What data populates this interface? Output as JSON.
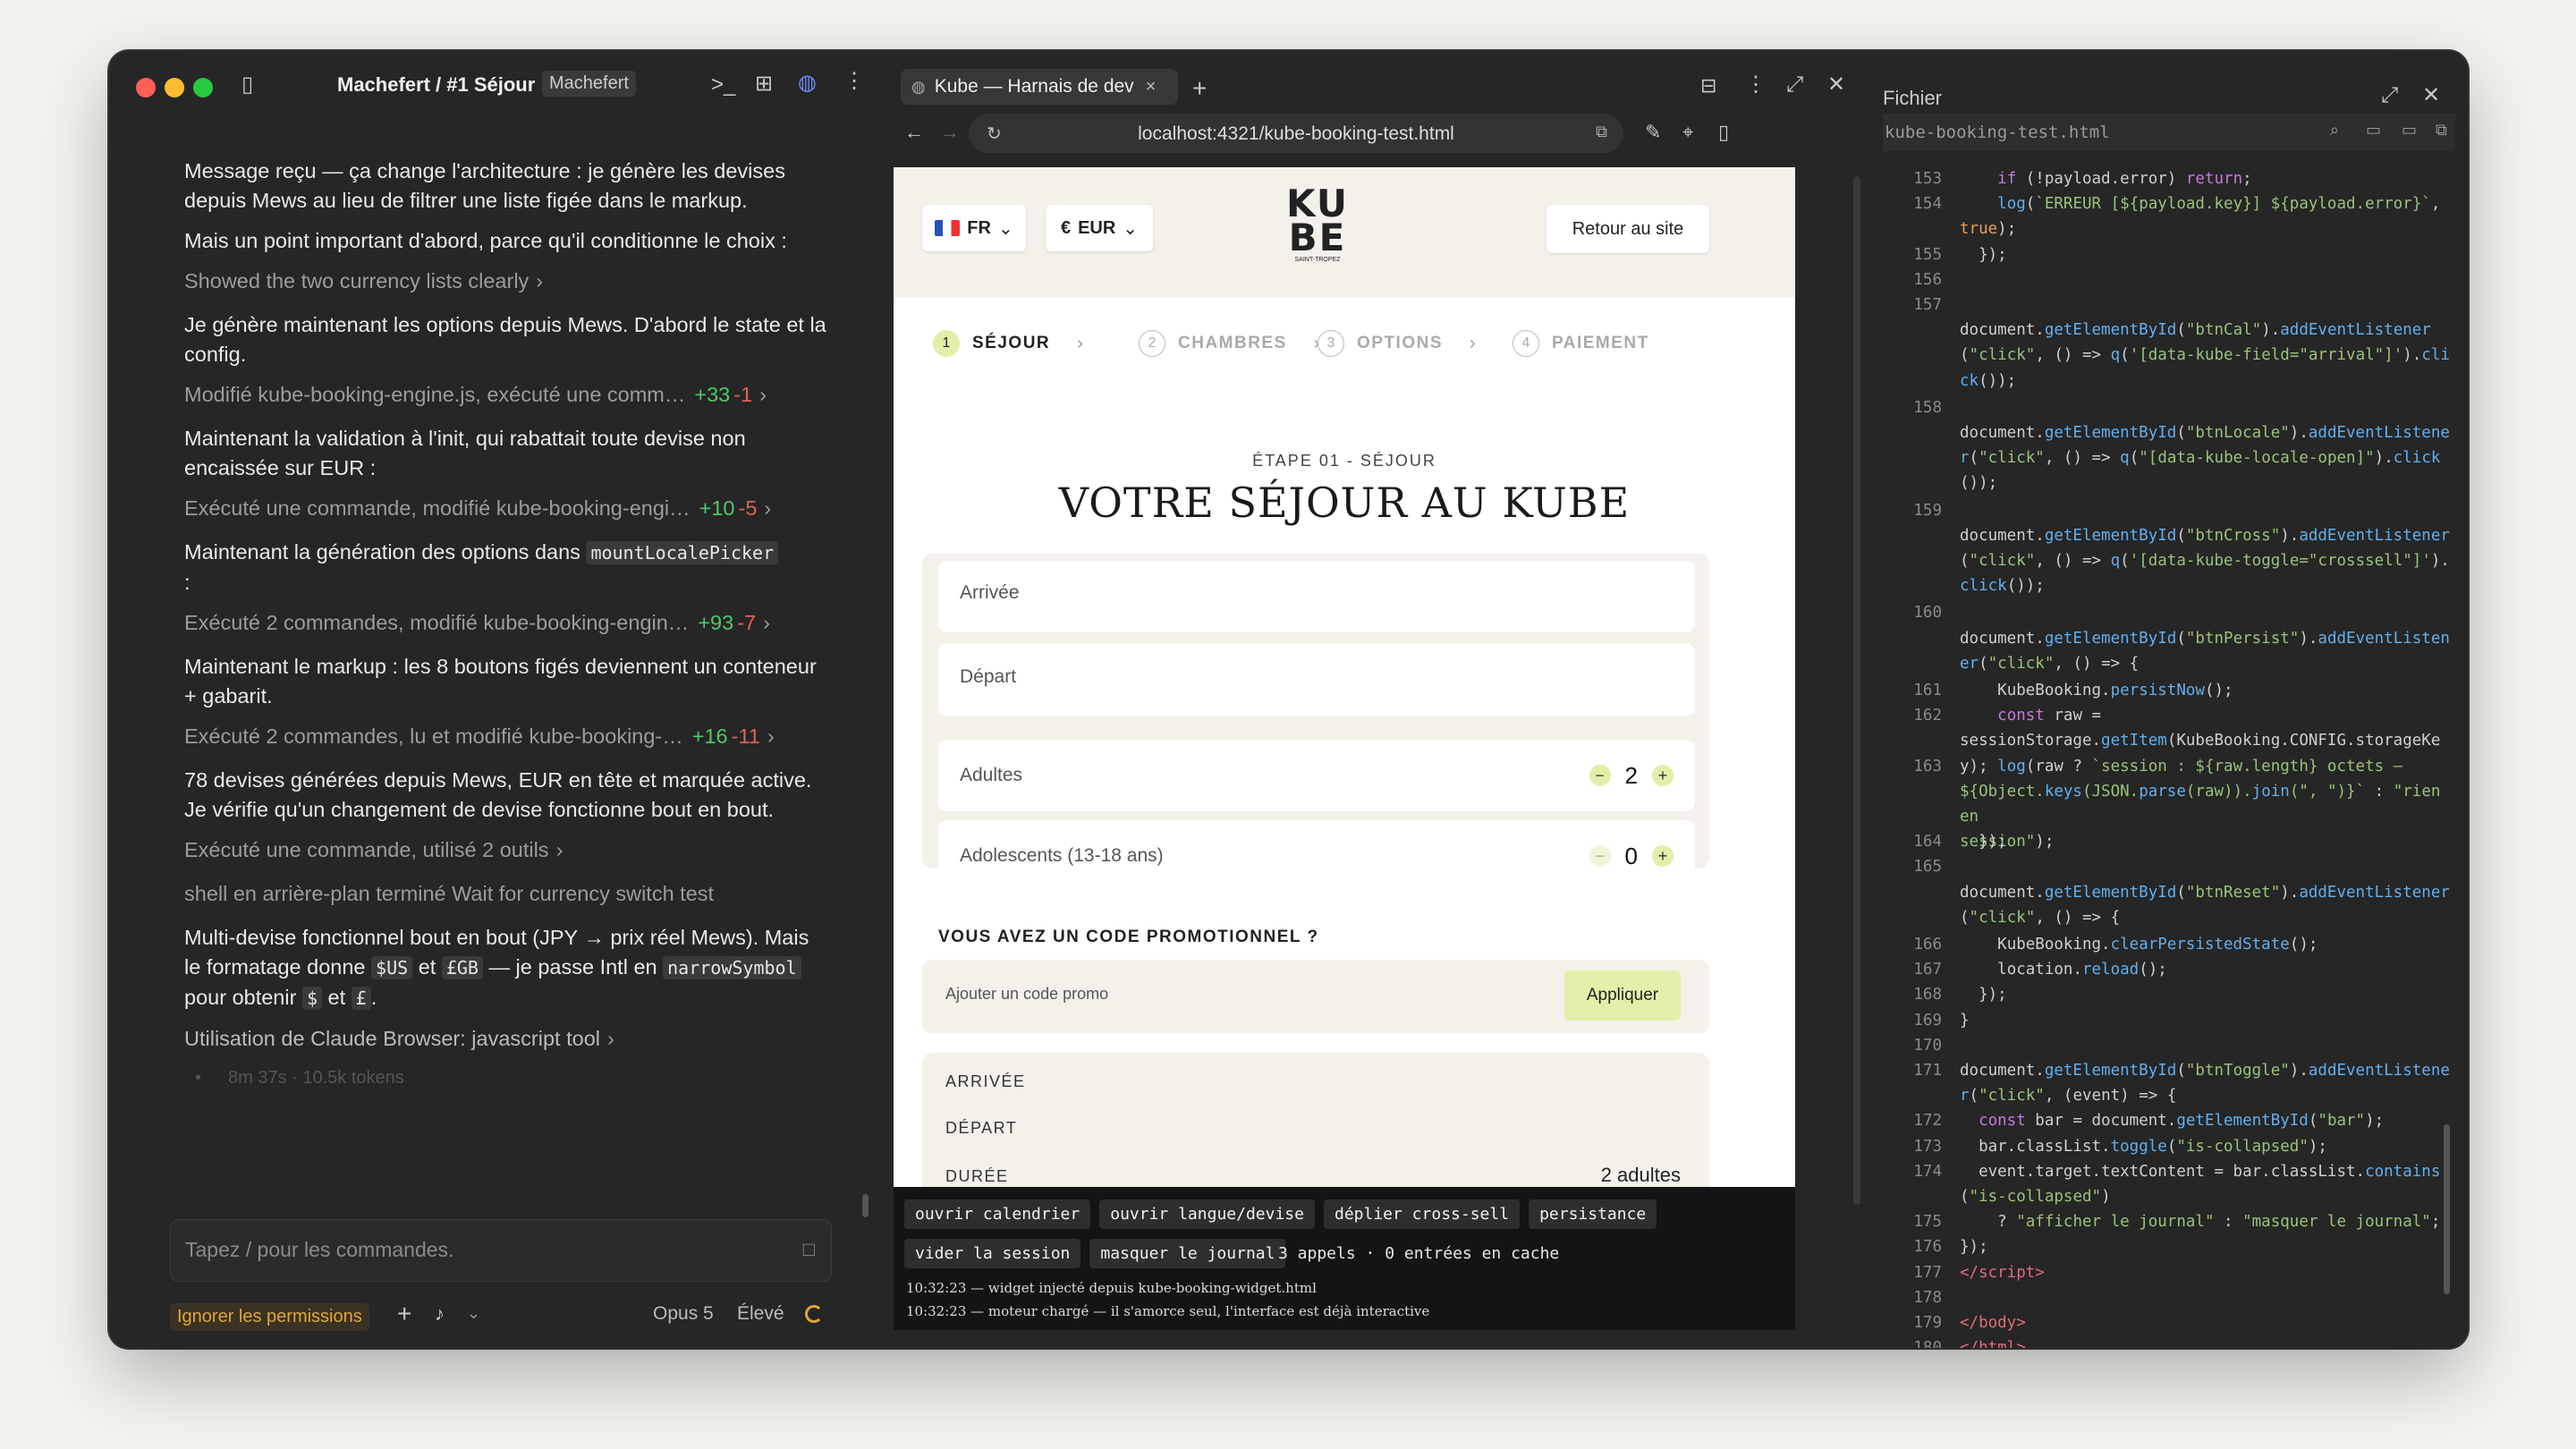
{
  "titlebar": {
    "title": "Machefert / #1 Séjour",
    "badge": "Machefert"
  },
  "chat": {
    "messages": [
      {
        "type": "msg",
        "text": "Message reçu — ça change l'architecture : je génère les devises depuis Mews au lieu de filtrer une liste figée dans le markup."
      },
      {
        "type": "msg",
        "text": "Mais un point important d'abord, parce qu'il conditionne le choix :"
      },
      {
        "type": "act",
        "text": "Showed the two currency lists clearly",
        "add": "",
        "del": ""
      },
      {
        "type": "msg",
        "text": "Je génère maintenant les options depuis Mews. D'abord le state et la config."
      },
      {
        "type": "act",
        "text": "Modifié kube-booking-engine.js, exécuté une comm…",
        "add": "+33",
        "del": "-1"
      },
      {
        "type": "msg",
        "text": "Maintenant la validation à l'init, qui rabattait toute devise non encaissée sur EUR :"
      },
      {
        "type": "act",
        "text": "Exécuté une commande, modifié kube-booking-engi…",
        "add": "+10",
        "del": "-5"
      },
      {
        "type": "msgcode",
        "text": "Maintenant la génération des options dans",
        "code": "mountLocalePicker",
        "after": ":"
      },
      {
        "type": "act",
        "text": "Exécuté 2 commandes, modifié kube-booking-engin…",
        "add": "+93",
        "del": "-7"
      },
      {
        "type": "msg",
        "text": "Maintenant le markup : les 8 boutons figés deviennent un conteneur + gabarit."
      },
      {
        "type": "act",
        "text": "Exécuté 2 commandes, lu et modifié kube-booking-…",
        "add": "+16",
        "del": "-11"
      },
      {
        "type": "msg",
        "text": "78 devises générées depuis Mews, EUR en tête et marquée active. Je vérifie qu'un changement de devise fonctionne bout en bout."
      },
      {
        "type": "act",
        "text": "Exécuté une commande, utilisé 2 outils",
        "add": "",
        "del": ""
      },
      {
        "type": "act",
        "text": "shell en arrière-plan terminé Wait for currency switch test",
        "add": "",
        "del": "",
        "nochev": true
      }
    ],
    "multi": {
      "p1": "Multi-devise fonctionnel bout en bout (JPY → prix réel Mews). Mais le formatage donne",
      "c1": "$US",
      "p2": "et",
      "c2": "£GB",
      "p3": "— je passe Intl en",
      "c3": "narrowSymbol",
      "p4": "pour obtenir",
      "c4": "$",
      "p5": "et",
      "c5": "£",
      "p6": "."
    },
    "tool": "Utilisation de Claude Browser: javascript tool",
    "status": "8m 37s · 10.5k tokens",
    "input_placeholder": "Tapez / pour les commandes.",
    "permissions": "Ignorer les permissions",
    "model": "Opus 5",
    "effort": "Élevé"
  },
  "browser": {
    "tab_title": "Kube — Harnais de dev",
    "url": "localhost:4321/kube-booking-test.html",
    "lang": "FR",
    "currency": "EUR",
    "currency_symbol": "€",
    "back_button": "Retour au site",
    "logo_sub": "SAINT-TROPEZ",
    "steps": [
      {
        "n": "1",
        "label": "SÉJOUR"
      },
      {
        "n": "2",
        "label": "CHAMBRES"
      },
      {
        "n": "3",
        "label": "OPTIONS"
      },
      {
        "n": "4",
        "label": "PAIEMENT"
      }
    ],
    "step_kicker": "ÉTAPE 01 - SÉJOUR",
    "heading": "VOTRE SÉJOUR AU KUBE",
    "arrival": "Arrivée",
    "departure": "Départ",
    "adults_label": "Adultes",
    "adults_value": "2",
    "teens_label": "Adolescents (13-18 ans)",
    "teens_value": "0",
    "promo_title": "VOUS AVEZ UN CODE PROMOTIONNEL ?",
    "promo_placeholder": "Ajouter un code promo",
    "promo_button": "Appliquer",
    "summary": {
      "arrival": "ARRIVÉE",
      "departure": "DÉPART",
      "duration": "DURÉE",
      "guests": "2 adultes"
    },
    "devtools": {
      "chips_row1": [
        "ouvrir calendrier",
        "ouvrir langue/devise",
        "déplier cross-sell",
        "persistance"
      ],
      "chips_row2": [
        "vider la session",
        "masquer le journal"
      ],
      "calls": "3 appels · 0 entrées en cache",
      "log": [
        "10:32:23 — widget injecté depuis kube-booking-widget.html",
        "10:32:23 — moteur chargé — il s'amorce seul, l'interface est déjà interactive"
      ]
    }
  },
  "file_panel": {
    "title": "Fichier",
    "filename": "kube-booking-test.html"
  },
  "colors": {
    "accent_green": "#4cc96a",
    "accent_red": "#e0605a",
    "promo_button": "#e3eea9",
    "permission_text": "#e0a53a"
  }
}
